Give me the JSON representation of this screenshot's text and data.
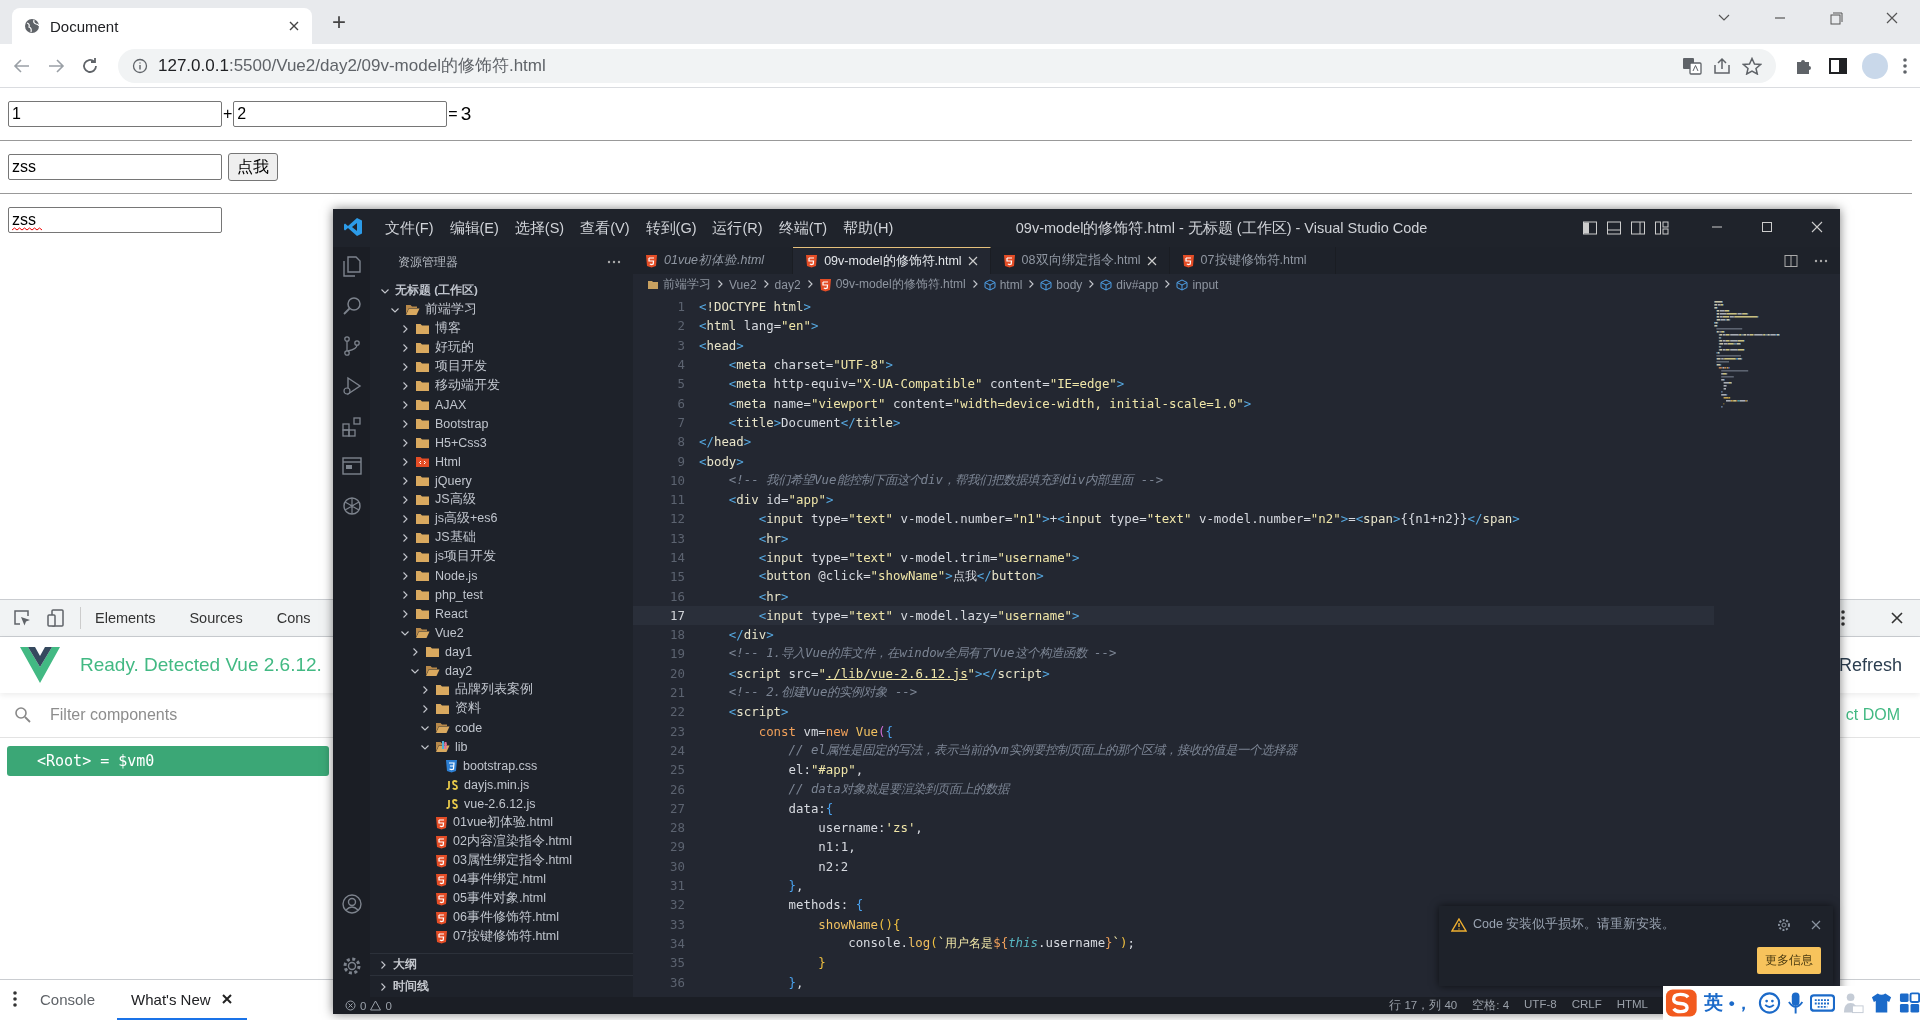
{
  "browser": {
    "tab_title": "Document",
    "new_tab": "+",
    "url_host": "127.0.0.1",
    "url_path": ":5500/Vue2/day2/09v-model的修饰符.html"
  },
  "page": {
    "num1": "1",
    "plus": "+",
    "num2": "2",
    "equals": "=",
    "sum": "3",
    "name_value": "zss",
    "button": "点我",
    "lazy_value": "zss",
    "lazy_misspelled": true
  },
  "devtools": {
    "tabs": [
      "Elements",
      "Sources",
      "Cons"
    ],
    "vue_status": "Ready. Detected Vue 2.6.12.",
    "refresh": "Refresh",
    "filter_placeholder": "Filter components",
    "select_dom": "ct DOM",
    "root_row": {
      "label": "<Root> = $vm0",
      "selected": true
    },
    "drawer_tabs": [
      {
        "label": "Console",
        "selected": false
      },
      {
        "label": "What's New",
        "selected": true
      }
    ]
  },
  "vscode": {
    "menus": [
      "文件(F)",
      "编辑(E)",
      "选择(S)",
      "查看(V)",
      "转到(G)",
      "运行(R)",
      "终端(T)",
      "帮助(H)"
    ],
    "title": "09v-model的修饰符.html - 无标题 (工作区) - Visual Studio Code",
    "explorer_title": "资源管理器",
    "tree": [
      {
        "label": "无标题 (工作区)",
        "kind": "workspace",
        "expanded": true,
        "children": [
          {
            "label": "前端学习",
            "kind": "folder",
            "expanded": true,
            "children": [
              {
                "label": "博客",
                "kind": "folder",
                "expanded": false
              },
              {
                "label": "好玩的",
                "kind": "folder",
                "expanded": false
              },
              {
                "label": "项目开发",
                "kind": "folder",
                "expanded": false
              },
              {
                "label": "移动端开发",
                "kind": "folder",
                "expanded": false
              },
              {
                "label": "AJAX",
                "kind": "folder",
                "expanded": false
              },
              {
                "label": "Bootstrap",
                "kind": "folder",
                "expanded": false
              },
              {
                "label": "H5+Css3",
                "kind": "folder",
                "expanded": false
              },
              {
                "label": "Html",
                "kind": "html-folder",
                "expanded": false
              },
              {
                "label": "jQuery",
                "kind": "folder",
                "expanded": false
              },
              {
                "label": "JS高级",
                "kind": "folder",
                "expanded": false
              },
              {
                "label": "js高级+es6",
                "kind": "folder",
                "expanded": false
              },
              {
                "label": "JS基础",
                "kind": "folder",
                "expanded": false
              },
              {
                "label": "js项目开发",
                "kind": "folder",
                "expanded": false
              },
              {
                "label": "Node.js",
                "kind": "folder",
                "expanded": false
              },
              {
                "label": "php_test",
                "kind": "folder",
                "expanded": false
              },
              {
                "label": "React",
                "kind": "folder",
                "expanded": false
              },
              {
                "label": "Vue2",
                "kind": "folder",
                "expanded": true,
                "children": [
                  {
                    "label": "day1",
                    "kind": "folder",
                    "expanded": false
                  },
                  {
                    "label": "day2",
                    "kind": "folder",
                    "expanded": true,
                    "children": [
                      {
                        "label": "品牌列表案例",
                        "kind": "folder",
                        "expanded": false
                      },
                      {
                        "label": "资料",
                        "kind": "folder",
                        "expanded": false
                      },
                      {
                        "label": "code",
                        "kind": "folder",
                        "expanded": true
                      },
                      {
                        "label": "lib",
                        "kind": "lib-folder",
                        "expanded": true,
                        "children": [
                          {
                            "label": "bootstrap.css",
                            "kind": "css-file"
                          },
                          {
                            "label": "dayjs.min.js",
                            "kind": "js-file"
                          },
                          {
                            "label": "vue-2.6.12.js",
                            "kind": "js-file"
                          }
                        ]
                      },
                      {
                        "label": "01vue初体验.html",
                        "kind": "html-file"
                      },
                      {
                        "label": "02内容渲染指令.html",
                        "kind": "html-file"
                      },
                      {
                        "label": "03属性绑定指令.html",
                        "kind": "html-file"
                      },
                      {
                        "label": "04事件绑定.html",
                        "kind": "html-file"
                      },
                      {
                        "label": "05事件对象.html",
                        "kind": "html-file"
                      },
                      {
                        "label": "06事件修饰符.html",
                        "kind": "html-file"
                      },
                      {
                        "label": "07按键修饰符.html",
                        "kind": "html-file"
                      }
                    ]
                  }
                ]
              }
            ]
          }
        ]
      }
    ],
    "panels": [
      "大纲",
      "时间线"
    ],
    "editor_tabs": [
      {
        "label": "01vue初体验.html",
        "selected": false,
        "preview": true,
        "closable": false
      },
      {
        "label": "09v-model的修饰符.html",
        "selected": true,
        "preview": false,
        "closable": true
      },
      {
        "label": "08双向绑定指令.html",
        "selected": false,
        "preview": false,
        "closable": true
      },
      {
        "label": "07按键修饰符.html",
        "selected": false,
        "preview": false,
        "closable": false
      }
    ],
    "breadcrumbs": [
      {
        "label": "前端学习",
        "kind": "folder"
      },
      {
        "label": "Vue2",
        "kind": "plain"
      },
      {
        "label": "day2",
        "kind": "plain"
      },
      {
        "label": "09v-model的修饰符.html",
        "kind": "file"
      },
      {
        "label": "html",
        "kind": "element"
      },
      {
        "label": "body",
        "kind": "element"
      },
      {
        "label": "div#app",
        "kind": "element"
      },
      {
        "label": "input",
        "kind": "element"
      }
    ],
    "code_lines": [
      {
        "number": "1",
        "current": false,
        "tokens": [
          {
            "kind": "punct",
            "text": "<"
          },
          {
            "kind": "tag",
            "text": "!DOCTYPE html"
          },
          {
            "kind": "punct",
            "text": ">"
          }
        ]
      },
      {
        "number": "2",
        "current": false,
        "tokens": [
          {
            "kind": "punct",
            "text": "<"
          },
          {
            "kind": "tag",
            "text": "html"
          },
          {
            "kind": "attr",
            "text": " lang"
          },
          {
            "kind": "text",
            "text": "="
          },
          {
            "kind": "str",
            "text": "\"en\""
          },
          {
            "kind": "punct",
            "text": ">"
          }
        ]
      },
      {
        "number": "3",
        "current": false,
        "tokens": [
          {
            "kind": "punct",
            "text": "<"
          },
          {
            "kind": "tag",
            "text": "head"
          },
          {
            "kind": "punct",
            "text": ">"
          }
        ]
      },
      {
        "number": "4",
        "current": false,
        "tokens": [
          {
            "kind": "punct",
            "text": "    <"
          },
          {
            "kind": "tag",
            "text": "meta"
          },
          {
            "kind": "attr",
            "text": " charset"
          },
          {
            "kind": "text",
            "text": "="
          },
          {
            "kind": "str",
            "text": "\"UTF-8\""
          },
          {
            "kind": "punct",
            "text": ">"
          }
        ]
      },
      {
        "number": "5",
        "current": false,
        "tokens": [
          {
            "kind": "punct",
            "text": "    <"
          },
          {
            "kind": "tag",
            "text": "meta"
          },
          {
            "kind": "attr",
            "text": " http-equiv"
          },
          {
            "kind": "text",
            "text": "="
          },
          {
            "kind": "str",
            "text": "\"X-UA-Compatible\""
          },
          {
            "kind": "attr",
            "text": " content"
          },
          {
            "kind": "text",
            "text": "="
          },
          {
            "kind": "str",
            "text": "\"IE=edge\""
          },
          {
            "kind": "punct",
            "text": ">"
          }
        ]
      },
      {
        "number": "6",
        "current": false,
        "tokens": [
          {
            "kind": "punct",
            "text": "    <"
          },
          {
            "kind": "tag",
            "text": "meta"
          },
          {
            "kind": "attr",
            "text": " name"
          },
          {
            "kind": "text",
            "text": "="
          },
          {
            "kind": "str",
            "text": "\"viewport\""
          },
          {
            "kind": "attr",
            "text": " content"
          },
          {
            "kind": "text",
            "text": "="
          },
          {
            "kind": "str",
            "text": "\"width=device-width, initial-scale=1.0\""
          },
          {
            "kind": "punct",
            "text": ">"
          }
        ]
      },
      {
        "number": "7",
        "current": false,
        "tokens": [
          {
            "kind": "punct",
            "text": "    <"
          },
          {
            "kind": "tag",
            "text": "title"
          },
          {
            "kind": "punct",
            "text": ">"
          },
          {
            "kind": "text",
            "text": "Document"
          },
          {
            "kind": "punct",
            "text": "</"
          },
          {
            "kind": "tag",
            "text": "title"
          },
          {
            "kind": "punct",
            "text": ">"
          }
        ]
      },
      {
        "number": "8",
        "current": false,
        "tokens": [
          {
            "kind": "punct",
            "text": "</"
          },
          {
            "kind": "tag",
            "text": "head"
          },
          {
            "kind": "punct",
            "text": ">"
          }
        ]
      },
      {
        "number": "9",
        "current": false,
        "tokens": [
          {
            "kind": "punct",
            "text": "<"
          },
          {
            "kind": "tag",
            "text": "body"
          },
          {
            "kind": "punct",
            "text": ">"
          }
        ]
      },
      {
        "number": "10",
        "current": false,
        "tokens": [
          {
            "kind": "comment",
            "text": "    <!-- 我们希望Vue能控制下面这个div，帮我们把数据填充到div内部里面 -->"
          }
        ]
      },
      {
        "number": "11",
        "current": false,
        "tokens": [
          {
            "kind": "punct",
            "text": "    <"
          },
          {
            "kind": "tag",
            "text": "div"
          },
          {
            "kind": "attr",
            "text": " id"
          },
          {
            "kind": "text",
            "text": "="
          },
          {
            "kind": "str",
            "text": "\"app\""
          },
          {
            "kind": "punct",
            "text": ">"
          }
        ]
      },
      {
        "number": "12",
        "current": false,
        "tokens": [
          {
            "kind": "punct",
            "text": "        <"
          },
          {
            "kind": "tag",
            "text": "input"
          },
          {
            "kind": "attr",
            "text": " type"
          },
          {
            "kind": "text",
            "text": "="
          },
          {
            "kind": "str",
            "text": "\"text\""
          },
          {
            "kind": "attr",
            "text": " v-model.number"
          },
          {
            "kind": "text",
            "text": "="
          },
          {
            "kind": "str",
            "text": "\"n1\""
          },
          {
            "kind": "punct",
            "text": ">"
          },
          {
            "kind": "text",
            "text": "+"
          },
          {
            "kind": "punct",
            "text": "<"
          },
          {
            "kind": "tag",
            "text": "input"
          },
          {
            "kind": "attr",
            "text": " type"
          },
          {
            "kind": "text",
            "text": "="
          },
          {
            "kind": "str",
            "text": "\"text\""
          },
          {
            "kind": "attr",
            "text": " v-model.number"
          },
          {
            "kind": "text",
            "text": "="
          },
          {
            "kind": "str",
            "text": "\"n2\""
          },
          {
            "kind": "punct",
            "text": ">"
          },
          {
            "kind": "text",
            "text": "="
          },
          {
            "kind": "punct",
            "text": "<"
          },
          {
            "kind": "tag",
            "text": "span"
          },
          {
            "kind": "punct",
            "text": ">"
          },
          {
            "kind": "text",
            "text": "{{n1+n2}}"
          },
          {
            "kind": "punct",
            "text": "</"
          },
          {
            "kind": "tag",
            "text": "span"
          },
          {
            "kind": "punct",
            "text": ">"
          }
        ]
      },
      {
        "number": "13",
        "current": false,
        "tokens": [
          {
            "kind": "punct",
            "text": "        <"
          },
          {
            "kind": "tag",
            "text": "hr"
          },
          {
            "kind": "punct",
            "text": ">"
          }
        ]
      },
      {
        "number": "14",
        "current": false,
        "tokens": [
          {
            "kind": "punct",
            "text": "        <"
          },
          {
            "kind": "tag",
            "text": "input"
          },
          {
            "kind": "attr",
            "text": " type"
          },
          {
            "kind": "text",
            "text": "="
          },
          {
            "kind": "str",
            "text": "\"text\""
          },
          {
            "kind": "attr",
            "text": " v-model.trim"
          },
          {
            "kind": "text",
            "text": "="
          },
          {
            "kind": "str",
            "text": "\"username\""
          },
          {
            "kind": "punct",
            "text": ">"
          }
        ]
      },
      {
        "number": "15",
        "current": false,
        "tokens": [
          {
            "kind": "punct",
            "text": "        <"
          },
          {
            "kind": "tag",
            "text": "button"
          },
          {
            "kind": "attr",
            "text": " @click"
          },
          {
            "kind": "text",
            "text": "="
          },
          {
            "kind": "str",
            "text": "\"showName\""
          },
          {
            "kind": "punct",
            "text": ">"
          },
          {
            "kind": "text",
            "text": "点我"
          },
          {
            "kind": "punct",
            "text": "</"
          },
          {
            "kind": "tag",
            "text": "button"
          },
          {
            "kind": "punct",
            "text": ">"
          }
        ]
      },
      {
        "number": "16",
        "current": false,
        "tokens": [
          {
            "kind": "punct",
            "text": "        <"
          },
          {
            "kind": "tag",
            "text": "hr"
          },
          {
            "kind": "punct",
            "text": ">"
          }
        ]
      },
      {
        "number": "17",
        "current": true,
        "tokens": [
          {
            "kind": "punct",
            "text": "        <"
          },
          {
            "kind": "tag",
            "text": "input"
          },
          {
            "kind": "attr",
            "text": " type"
          },
          {
            "kind": "text",
            "text": "="
          },
          {
            "kind": "str",
            "text": "\"text\""
          },
          {
            "kind": "attr",
            "text": " v-model.lazy"
          },
          {
            "kind": "text",
            "text": "="
          },
          {
            "kind": "str",
            "text": "\"username\""
          },
          {
            "kind": "punct",
            "text": ">"
          }
        ]
      },
      {
        "number": "18",
        "current": false,
        "tokens": [
          {
            "kind": "punct",
            "text": "    </"
          },
          {
            "kind": "tag",
            "text": "div"
          },
          {
            "kind": "punct",
            "text": ">"
          }
        ]
      },
      {
        "number": "19",
        "current": false,
        "tokens": [
          {
            "kind": "comment",
            "text": "    <!-- 1.导入Vue的库文件，在window全局有了Vue这个构造函数 -->"
          }
        ]
      },
      {
        "number": "20",
        "current": false,
        "tokens": [
          {
            "kind": "punct",
            "text": "    <"
          },
          {
            "kind": "tag",
            "text": "script"
          },
          {
            "kind": "attr",
            "text": " src"
          },
          {
            "kind": "text",
            "text": "="
          },
          {
            "kind": "str",
            "text": "\""
          },
          {
            "kind": "link",
            "text": "./lib/vue-2.6.12.js"
          },
          {
            "kind": "str",
            "text": "\""
          },
          {
            "kind": "punct",
            "text": "></"
          },
          {
            "kind": "tag",
            "text": "script"
          },
          {
            "kind": "punct",
            "text": ">"
          }
        ]
      },
      {
        "number": "21",
        "current": false,
        "tokens": [
          {
            "kind": "comment",
            "text": "    <!-- 2.创建Vue的实例对象 -->"
          }
        ]
      },
      {
        "number": "22",
        "current": false,
        "tokens": [
          {
            "kind": "punct",
            "text": "    <"
          },
          {
            "kind": "tag",
            "text": "script"
          },
          {
            "kind": "punct",
            "text": ">"
          }
        ]
      },
      {
        "number": "23",
        "current": false,
        "tokens": [
          {
            "kind": "keyword",
            "text": "        const"
          },
          {
            "kind": "text",
            "text": " vm="
          },
          {
            "kind": "keyword",
            "text": "new"
          },
          {
            "kind": "function",
            "text": " Vue"
          },
          {
            "kind": "bracket1",
            "text": "("
          },
          {
            "kind": "bracket2",
            "text": "{"
          }
        ]
      },
      {
        "number": "24",
        "current": false,
        "tokens": [
          {
            "kind": "comment",
            "text": "            // el属性是固定的写法，表示当前的vm实例要控制页面上的那个区域，接收的值是一个选择器"
          }
        ]
      },
      {
        "number": "25",
        "current": false,
        "tokens": [
          {
            "kind": "text",
            "text": "            el:"
          },
          {
            "kind": "str",
            "text": "\"#app\""
          },
          {
            "kind": "text",
            "text": ","
          }
        ]
      },
      {
        "number": "26",
        "current": false,
        "tokens": [
          {
            "kind": "comment",
            "text": "            // data对象就是要渲染到页面上的数据"
          }
        ]
      },
      {
        "number": "27",
        "current": false,
        "tokens": [
          {
            "kind": "text",
            "text": "            data:"
          },
          {
            "kind": "bracket2",
            "text": "{"
          }
        ]
      },
      {
        "number": "28",
        "current": false,
        "tokens": [
          {
            "kind": "text",
            "text": "                username:"
          },
          {
            "kind": "str",
            "text": "'zs'"
          },
          {
            "kind": "text",
            "text": ","
          }
        ]
      },
      {
        "number": "29",
        "current": false,
        "tokens": [
          {
            "kind": "text",
            "text": "                n1:1,"
          }
        ]
      },
      {
        "number": "30",
        "current": false,
        "tokens": [
          {
            "kind": "text",
            "text": "                n2:2"
          }
        ]
      },
      {
        "number": "31",
        "current": false,
        "tokens": [
          {
            "kind": "bracket2",
            "text": "            }"
          },
          {
            "kind": "text",
            "text": ","
          }
        ]
      },
      {
        "number": "32",
        "current": false,
        "tokens": [
          {
            "kind": "text",
            "text": "            methods: "
          },
          {
            "kind": "bracket2",
            "text": "{"
          }
        ]
      },
      {
        "number": "33",
        "current": false,
        "tokens": [
          {
            "kind": "function",
            "text": "                showName"
          },
          {
            "kind": "bracket3",
            "text": "(){"
          }
        ]
      },
      {
        "number": "34",
        "current": false,
        "tokens": [
          {
            "kind": "text",
            "text": "                    console."
          },
          {
            "kind": "function",
            "text": "log"
          },
          {
            "kind": "bracket3",
            "text": "("
          },
          {
            "kind": "str",
            "text": "`用户名是"
          },
          {
            "kind": "keyword",
            "text": "${"
          },
          {
            "kind": "this",
            "text": "this"
          },
          {
            "kind": "text",
            "text": ".username"
          },
          {
            "kind": "keyword",
            "text": "}"
          },
          {
            "kind": "str",
            "text": "`"
          },
          {
            "kind": "bracket3",
            "text": ")"
          },
          {
            "kind": "text",
            "text": ";"
          }
        ]
      },
      {
        "number": "35",
        "current": false,
        "tokens": [
          {
            "kind": "bracket3",
            "text": "                }"
          }
        ]
      },
      {
        "number": "36",
        "current": false,
        "tokens": [
          {
            "kind": "bracket2",
            "text": "            }"
          },
          {
            "kind": "text",
            "text": ","
          }
        ]
      }
    ],
    "status": {
      "errors": "0",
      "warnings": "0",
      "items": [
        "行 17，列 40",
        "空格: 4",
        "UTF-8",
        "CRLF",
        "HTML"
      ]
    },
    "notification": {
      "message": "Code 安装似乎损坏。请重新安装。",
      "button": "更多信息"
    }
  },
  "ime": {
    "mode": "英",
    "punct": "•，"
  }
}
